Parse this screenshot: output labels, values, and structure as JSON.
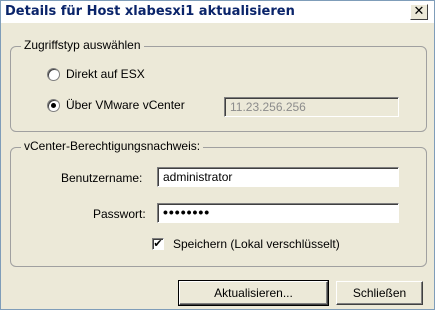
{
  "window": {
    "title": "Details für Host xlabesxi1 aktualisieren",
    "close_glyph": "✕"
  },
  "access_group": {
    "title": "Zugriffstyp auswählen",
    "option_direct": "Direkt auf ESX",
    "option_vcenter": "Über VMware vCenter",
    "vcenter_address": "11.23.256.256",
    "selected": "vcenter"
  },
  "credentials_group": {
    "title": "vCenter-Berechtigungsnachweis:",
    "username_label": "Benutzername:",
    "username_value": "administrator",
    "password_label": "Passwort:",
    "password_value": "••••••••",
    "save_label": "Speichern (Lokal verschlüsselt)",
    "save_checked": true,
    "check_glyph": "✔"
  },
  "buttons": {
    "update": "Aktualisieren...",
    "close": "Schließen"
  }
}
